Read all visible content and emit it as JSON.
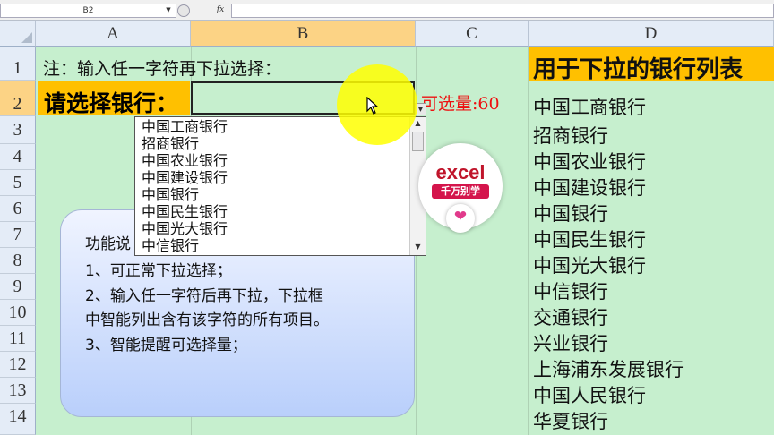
{
  "formula_bar": {
    "name_box": "B2",
    "fx_label": "fx",
    "formula": ""
  },
  "columns": [
    "A",
    "B",
    "C",
    "D"
  ],
  "rows": [
    "1",
    "2",
    "3",
    "4",
    "5",
    "6",
    "7",
    "8",
    "9",
    "10",
    "11",
    "12",
    "13",
    "14"
  ],
  "cells": {
    "a1": "注：输入任一字符再下拉选择：",
    "a2": "请选择银行：",
    "b2": "",
    "c2": "可选量:60",
    "d1": "用于下拉的银行列表"
  },
  "bank_list": [
    "中国工商银行",
    "招商银行",
    "中国农业银行",
    "中国建设银行",
    "中国银行",
    "中国民生银行",
    "中国光大银行",
    "中信银行",
    "交通银行",
    "兴业银行",
    "上海浦东发展银行",
    "中国人民银行",
    "华夏银行"
  ],
  "dropdown_items": [
    "中国工商银行",
    "招商银行",
    "中国农业银行",
    "中国建设银行",
    "中国银行",
    "中国民生银行",
    "中国光大银行",
    "中信银行"
  ],
  "callout": {
    "title": "功能说",
    "lines": [
      "1、可正常下拉选择；",
      "2、输入任一字符后再下拉，下拉框",
      "中智能列出含有该字符的所有项目。",
      "3、智能提醒可选择量；"
    ]
  },
  "logo": {
    "main": "excel",
    "sub": "千万别学"
  },
  "colors": {
    "sheet_bg": "#c6efce",
    "highlight": "#ffc000",
    "count_text": "#ee1111"
  }
}
